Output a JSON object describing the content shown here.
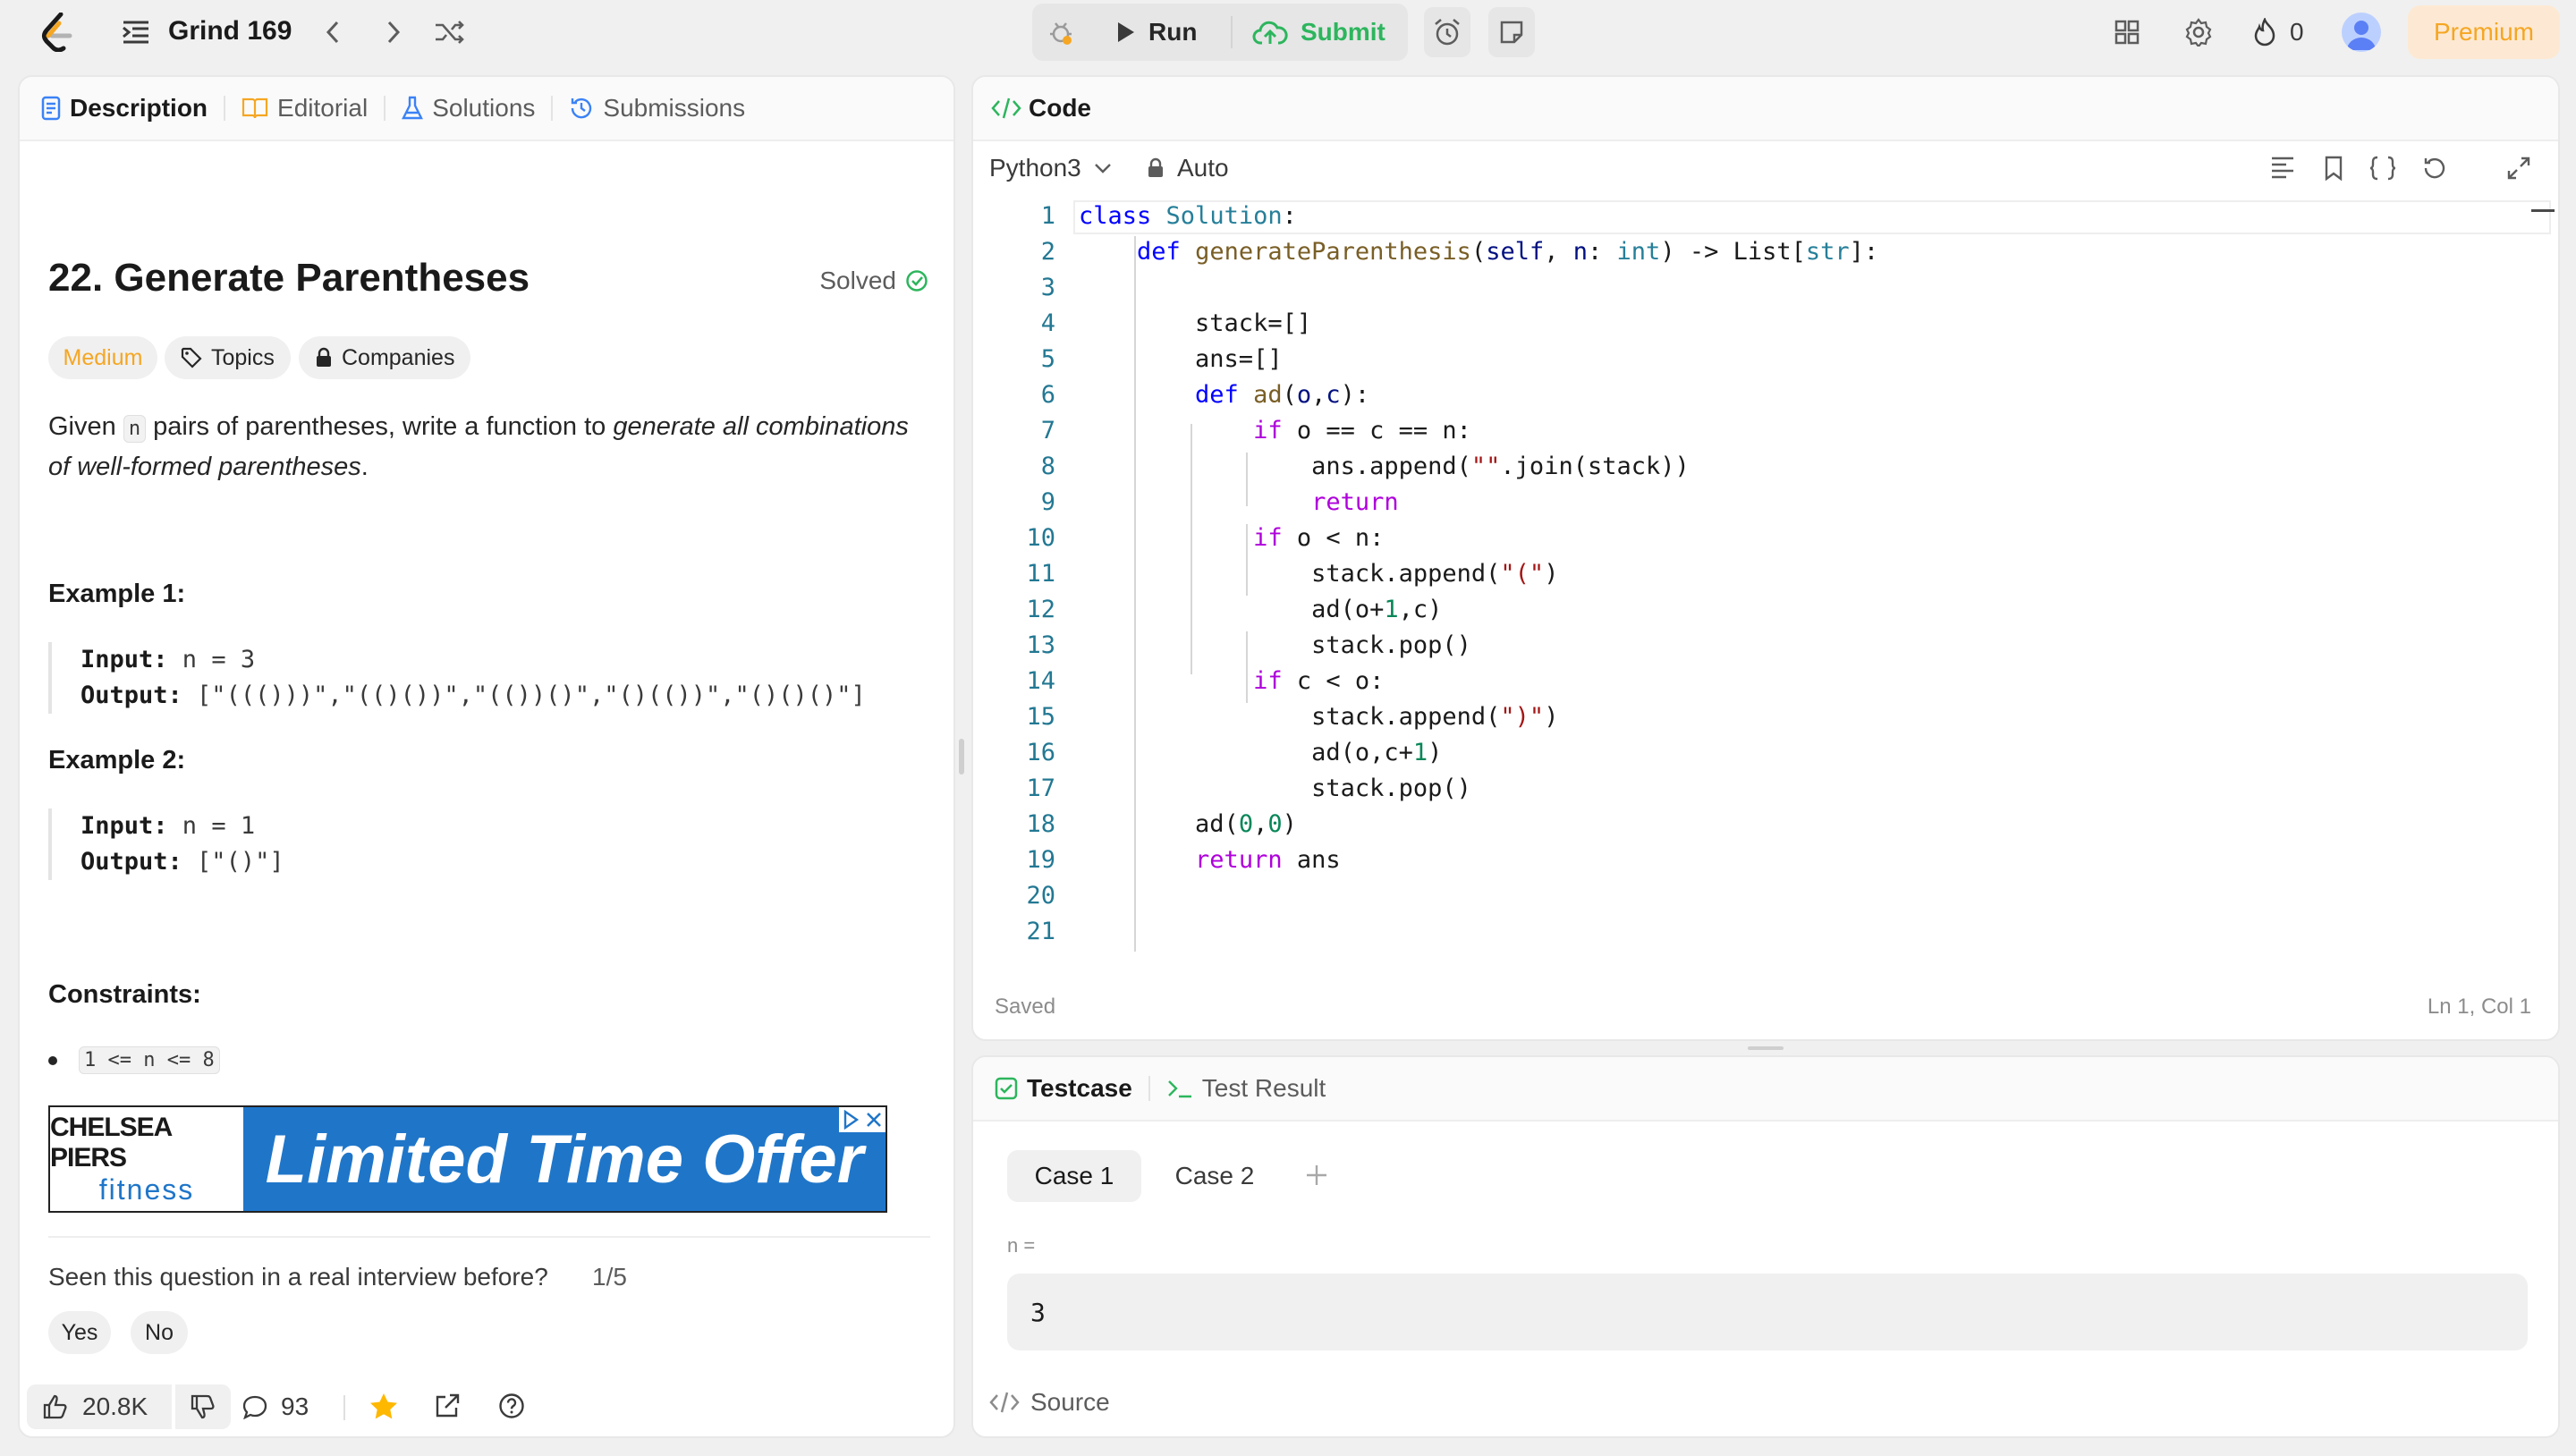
{
  "topbar": {
    "problem_list": "Grind 169",
    "run": "Run",
    "submit": "Submit",
    "streak": "0",
    "premium": "Premium"
  },
  "left": {
    "tabs": [
      "Description",
      "Editorial",
      "Solutions",
      "Submissions"
    ],
    "title": "22. Generate Parentheses",
    "solved": "Solved",
    "difficulty": "Medium",
    "topics": "Topics",
    "companies": "Companies",
    "desc": {
      "t1": "Given ",
      "code": "n",
      "t2": " pairs of parentheses, write a function to ",
      "em": "generate all combinations of well-formed parentheses",
      "t3": "."
    },
    "example1": {
      "heading": "Example 1:",
      "input_label": "Input:",
      "input": " n = 3",
      "output_label": "Output:",
      "output": " [\"((()))\",\"(()())\",\"(())()\",\"()(())\",\"()()()\"]"
    },
    "example2": {
      "heading": "Example 2:",
      "input_label": "Input:",
      "input": " n = 1",
      "output_label": "Output:",
      "output": " [\"()\"]"
    },
    "constraints_heading": "Constraints:",
    "constraint": "1 <= n <= 8",
    "ad": {
      "brand1": "CHELSEA PIERS",
      "brand2": "fitness",
      "offer": "Limited Time Offer"
    },
    "interview_q": "Seen this question in a real interview before?",
    "interview_count": "1/5",
    "yes": "Yes",
    "no": "No",
    "likes": "20.8K",
    "comments": "93"
  },
  "code": {
    "tab": "Code",
    "language": "Python3",
    "mode": "Auto",
    "saved": "Saved",
    "cursor": "Ln 1, Col 1",
    "line_numbers": [
      "1",
      "2",
      "3",
      "4",
      "5",
      "6",
      "7",
      "8",
      "9",
      "10",
      "11",
      "12",
      "13",
      "14",
      "15",
      "16",
      "17",
      "18",
      "19",
      "20",
      "21"
    ]
  },
  "test": {
    "tab1": "Testcase",
    "tab2": "Test Result",
    "case1": "Case 1",
    "case2": "Case 2",
    "var_label": "n =",
    "var_value": "3",
    "source": "Source"
  }
}
